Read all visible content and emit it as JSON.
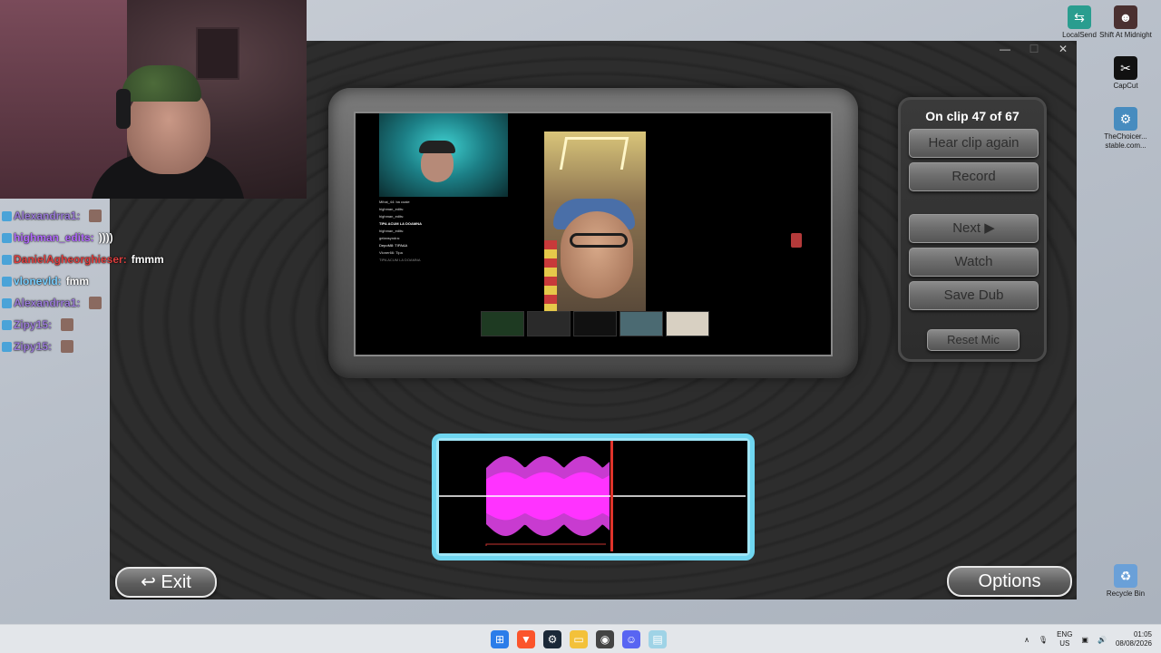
{
  "desktop": {
    "icons": [
      {
        "label": "LocalSend",
        "icon": "localsend-icon",
        "color": "#2a9d8f"
      },
      {
        "label": "Shift At Midnight",
        "icon": "game-icon",
        "color": "#4a3030"
      },
      {
        "label": "CapCut",
        "icon": "capcut-icon",
        "color": "#111111"
      },
      {
        "label": "TheChoicer... stable.com...",
        "icon": "godot-icon",
        "color": "#478cbf"
      },
      {
        "label": "Recycle Bin",
        "icon": "recycle-bin-icon",
        "color": "#6aa0d8"
      }
    ]
  },
  "chat": {
    "lines": [
      {
        "user": "Alexandrra1:",
        "color": "#9b7bd8",
        "msg": "",
        "emote": true
      },
      {
        "user": "highman_edits:",
        "color": "#b46bff",
        "msg": "))))",
        "emote": false
      },
      {
        "user": "DanielAgheorghieser:",
        "color": "#e04040",
        "msg": "fmmm",
        "emote": false
      },
      {
        "user": "vlonevld:",
        "color": "#7ad0ff",
        "msg": "fmm",
        "emote": false
      },
      {
        "user": "Alexandrra1:",
        "color": "#9b7bd8",
        "msg": "",
        "emote": true
      },
      {
        "user": "Zipy15:",
        "color": "#9b7bd8",
        "msg": "",
        "emote": true
      },
      {
        "user": "Zipy15:",
        "color": "#9b7bd8",
        "msg": "",
        "emote": true
      }
    ]
  },
  "game": {
    "clip_status": "On clip 47 of 67",
    "buttons": {
      "hear_again": "Hear clip again",
      "record": "Record",
      "next": "Next ▶",
      "watch": "Watch",
      "save_dub": "Save Dub",
      "reset_mic": "Reset Mic"
    },
    "exit_label": "↩ Exit",
    "options_label": "Options",
    "playhead": 0.56,
    "mini_chat": [
      "Mihai_44: ba coaie",
      "highman_edits:",
      "highman_edits:",
      "TIPA ACUM LA DOAMNA",
      "highman_edits:",
      "gelansyndra:",
      "DepoM8: TIPAAA",
      "Vloner66: Tipa",
      "TIPA ACUM LA DOAMNA"
    ]
  },
  "taskbar": {
    "apps": [
      {
        "icon": "windows-start-icon",
        "color": "#2b7de9"
      },
      {
        "icon": "brave-browser-icon",
        "color": "#fb542b"
      },
      {
        "icon": "steam-icon",
        "color": "#1b2838"
      },
      {
        "icon": "file-explorer-icon",
        "color": "#f3c13a"
      },
      {
        "icon": "obs-icon",
        "color": "#444444"
      },
      {
        "icon": "discord-icon",
        "color": "#5865f2"
      },
      {
        "icon": "notepad-icon",
        "color": "#9fd3e6"
      }
    ],
    "lang": "ENG",
    "region": "US",
    "time": "01:05",
    "date": "08/08/2026"
  }
}
